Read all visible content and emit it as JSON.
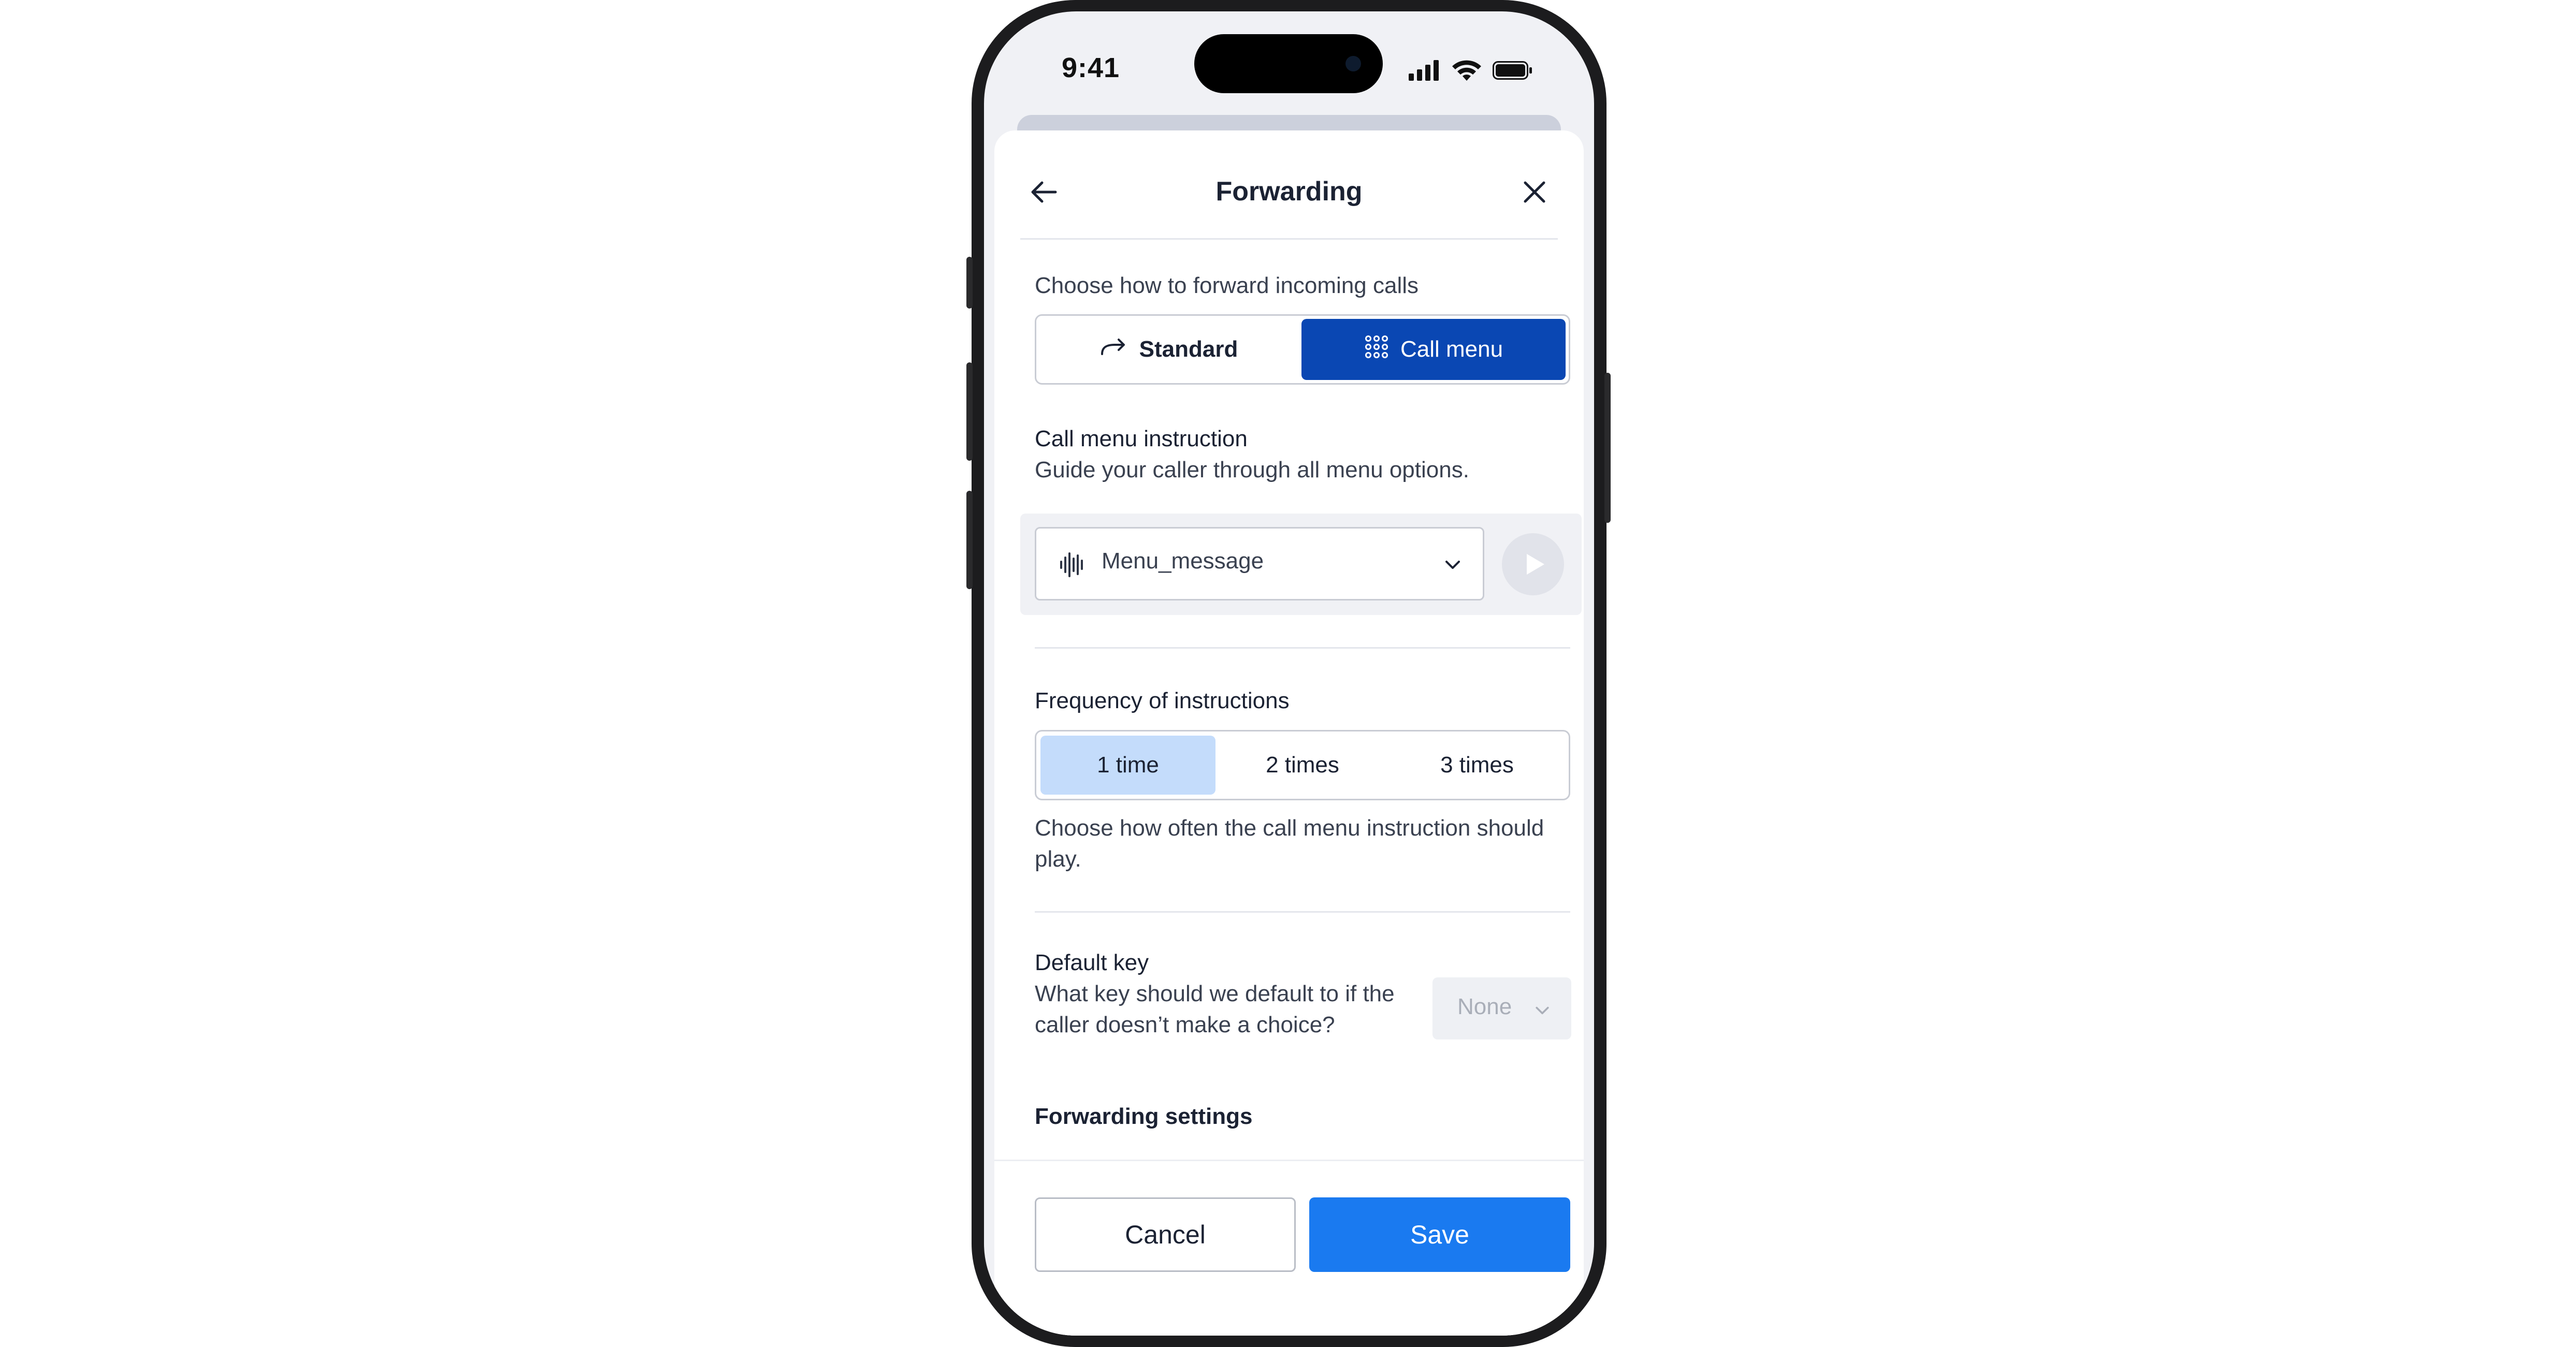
{
  "status_bar": {
    "time": "9:41"
  },
  "header": {
    "title": "Forwarding"
  },
  "forward_mode": {
    "prompt": "Choose how to forward incoming calls",
    "options": [
      "Standard",
      "Call menu"
    ],
    "selected": "Call menu"
  },
  "call_menu_instruction": {
    "title": "Call menu instruction",
    "description": "Guide your caller through all menu options.",
    "selected_file": "Menu_message"
  },
  "frequency": {
    "title": "Frequency of instructions",
    "options": [
      "1 time",
      "2 times",
      "3 times"
    ],
    "selected": "1 time",
    "help_line1": "Choose how often the call menu instruction should",
    "help_line2": "play."
  },
  "default_key": {
    "title": "Default key",
    "description_line1": "What key should we default to if the",
    "description_line2": "caller doesn’t make a choice?",
    "value": "None"
  },
  "forwarding_settings": {
    "title": "Forwarding settings"
  },
  "footer": {
    "cancel_label": "Cancel",
    "save_label": "Save"
  },
  "colors": {
    "primary": "#1a7af0",
    "selected_segment": "#0a47b3",
    "selected_frequency": "#c4dcfb"
  }
}
